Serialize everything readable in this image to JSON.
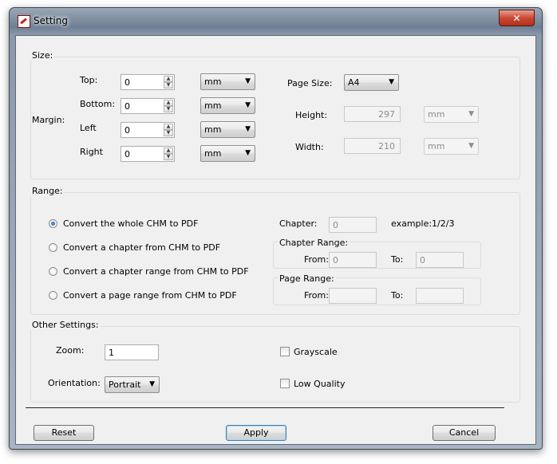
{
  "window": {
    "title": "Setting",
    "close_label": "✕"
  },
  "size": {
    "group_label": "Size:",
    "margin_label": "Margin:",
    "margins": [
      {
        "label": "Top:",
        "value": "0",
        "unit": "mm"
      },
      {
        "label": "Bottom:",
        "value": "0",
        "unit": "mm"
      },
      {
        "label": "Left",
        "value": "0",
        "unit": "mm"
      },
      {
        "label": "Right",
        "value": "0",
        "unit": "mm"
      }
    ],
    "page_size_label": "Page Size:",
    "page_size_value": "A4",
    "height_label": "Height:",
    "height_value": "297",
    "height_unit": "mm",
    "width_label": "Width:",
    "width_value": "210",
    "width_unit": "mm"
  },
  "range": {
    "group_label": "Range:",
    "options": [
      {
        "label": "Convert the whole CHM to PDF",
        "selected": true
      },
      {
        "label": "Convert a chapter from CHM to PDF",
        "selected": false
      },
      {
        "label": "Convert a chapter range from CHM to PDF",
        "selected": false
      },
      {
        "label": "Convert a page range from CHM to PDF",
        "selected": false
      }
    ],
    "chapter_label": "Chapter:",
    "chapter_value": "0",
    "chapter_example": "example:1/2/3",
    "chapter_range_label": "Chapter Range:",
    "chapter_from_label": "From:",
    "chapter_from_value": "0",
    "chapter_to_label": "To:",
    "chapter_to_value": "0",
    "page_range_label": "Page Range:",
    "page_from_label": "From:",
    "page_from_value": "",
    "page_to_label": "To:",
    "page_to_value": ""
  },
  "other": {
    "group_label": "Other Settings:",
    "zoom_label": "Zoom:",
    "zoom_value": "1",
    "orientation_label": "Orientation:",
    "orientation_value": "Portrait",
    "grayscale_label": "Grayscale",
    "grayscale_checked": false,
    "low_quality_label": "Low Quality",
    "low_quality_checked": false
  },
  "buttons": {
    "reset": "Reset",
    "apply": "Apply",
    "cancel": "Cancel"
  }
}
